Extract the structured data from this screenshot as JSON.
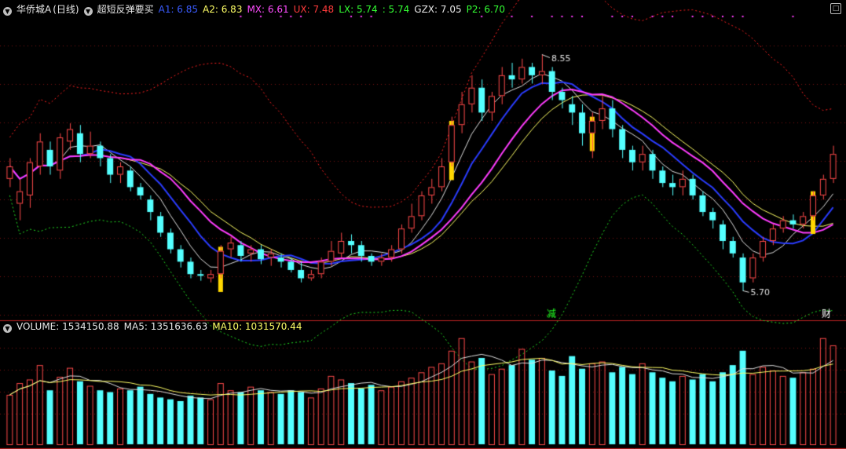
{
  "header": {
    "stock_name": "华侨城A",
    "period": "(日线)",
    "indicator": "超短反弹要买",
    "indicators": [
      {
        "label": "A1: 6.85",
        "color": "#3a5cff"
      },
      {
        "label": "A2: 6.83",
        "color": "#ffff66"
      },
      {
        "label": "MX: 6.61",
        "color": "#ff4dff"
      },
      {
        "label": "UX: 7.48",
        "color": "#ff3b3b"
      },
      {
        "label": "LX: 5.74",
        "color": "#33ff33"
      },
      {
        "label": ": 5.74",
        "color": "#33ff33"
      },
      {
        "label": "GZX: 7.05",
        "color": "#e8e8e8"
      },
      {
        "label": "P2: 6.70",
        "color": "#33ff33"
      }
    ]
  },
  "volume_header": {
    "items": [
      {
        "label": "VOLUME: 1534150.88",
        "color": "#e8e8e8"
      },
      {
        "label": "MA5: 1351636.63",
        "color": "#e8e8e8"
      },
      {
        "label": "MA10: 1031570.44",
        "color": "#ffff66"
      }
    ]
  },
  "annotations": {
    "high_label": "8.55",
    "low_label": "5.70",
    "marker_jian": "减",
    "marker_cai": "财"
  },
  "colors": {
    "background": "#000000",
    "up": "#ff4a4a",
    "down": "#54ffff",
    "grid": "#7a1010",
    "a1": "#2a3cff",
    "mx": "#ff3cff",
    "a2": "#ffff66",
    "gzx": "#e0e0e0",
    "ux": "#ff2020",
    "lx": "#22dd22",
    "signal": "#ffd700",
    "marker_jian": "#22ff22",
    "marker_cai": "#ffffff"
  },
  "chart_data": {
    "type": "candlestick",
    "price_axis": [
      5.4,
      9.0
    ],
    "signal_bar_indices": [
      21,
      44,
      58,
      80
    ],
    "high_index": 53,
    "low_index": 73,
    "candles": [
      [
        7.05,
        7.2,
        6.95,
        7.3
      ],
      [
        6.75,
        6.9,
        6.55,
        7.05
      ],
      [
        6.85,
        7.25,
        6.7,
        7.3
      ],
      [
        7.2,
        7.5,
        7.1,
        7.6
      ],
      [
        7.4,
        7.2,
        7.1,
        7.5
      ],
      [
        7.15,
        7.55,
        7.05,
        7.6
      ],
      [
        7.5,
        7.65,
        7.4,
        7.72
      ],
      [
        7.6,
        7.35,
        7.25,
        7.7
      ],
      [
        7.35,
        7.45,
        7.3,
        7.62
      ],
      [
        7.45,
        7.3,
        7.2,
        7.5
      ],
      [
        7.3,
        7.1,
        7.0,
        7.35
      ],
      [
        7.1,
        7.2,
        7.0,
        7.25
      ],
      [
        7.15,
        6.95,
        6.9,
        7.2
      ],
      [
        6.95,
        6.85,
        6.8,
        7.0
      ],
      [
        6.8,
        6.65,
        6.55,
        6.85
      ],
      [
        6.6,
        6.4,
        6.35,
        6.65
      ],
      [
        6.4,
        6.2,
        6.15,
        6.45
      ],
      [
        6.2,
        6.05,
        5.98,
        6.25
      ],
      [
        6.05,
        5.9,
        5.85,
        6.1
      ],
      [
        5.9,
        5.88,
        5.82,
        5.95
      ],
      [
        5.85,
        5.9,
        5.8,
        5.95
      ],
      [
        5.9,
        6.18,
        5.85,
        6.25
      ],
      [
        6.2,
        6.28,
        6.1,
        6.35
      ],
      [
        6.25,
        6.12,
        6.05,
        6.3
      ],
      [
        6.15,
        6.2,
        6.05,
        6.25
      ],
      [
        6.2,
        6.08,
        6.02,
        6.25
      ],
      [
        6.1,
        6.15,
        6.0,
        6.2
      ],
      [
        6.1,
        6.05,
        5.98,
        6.15
      ],
      [
        6.05,
        5.95,
        5.92,
        6.1
      ],
      [
        5.95,
        5.85,
        5.8,
        6.05
      ],
      [
        5.85,
        5.9,
        5.82,
        5.95
      ],
      [
        5.9,
        6.05,
        5.85,
        6.1
      ],
      [
        6.05,
        6.18,
        6.0,
        6.3
      ],
      [
        6.15,
        6.3,
        6.1,
        6.4
      ],
      [
        6.3,
        6.25,
        6.15,
        6.38
      ],
      [
        6.25,
        6.12,
        6.05,
        6.3
      ],
      [
        6.12,
        6.05,
        6.0,
        6.15
      ],
      [
        6.05,
        6.1,
        6.0,
        6.15
      ],
      [
        6.1,
        6.2,
        6.05,
        6.25
      ],
      [
        6.2,
        6.45,
        6.15,
        6.5
      ],
      [
        6.45,
        6.6,
        6.4,
        6.75
      ],
      [
        6.6,
        6.85,
        6.55,
        6.9
      ],
      [
        6.85,
        6.95,
        6.75,
        7.05
      ],
      [
        6.95,
        7.2,
        6.9,
        7.3
      ],
      [
        7.25,
        7.7,
        7.2,
        7.8
      ],
      [
        7.7,
        7.95,
        7.6,
        8.1
      ],
      [
        7.95,
        8.15,
        7.85,
        8.3
      ],
      [
        8.15,
        7.85,
        7.75,
        8.25
      ],
      [
        7.85,
        8.05,
        7.75,
        8.1
      ],
      [
        8.05,
        8.3,
        7.95,
        8.4
      ],
      [
        8.3,
        8.25,
        8.15,
        8.45
      ],
      [
        8.25,
        8.4,
        8.2,
        8.5
      ],
      [
        8.4,
        8.3,
        8.2,
        8.45
      ],
      [
        8.3,
        8.35,
        8.2,
        8.55
      ],
      [
        8.35,
        8.1,
        8.0,
        8.4
      ],
      [
        8.1,
        8.0,
        7.9,
        8.15
      ],
      [
        7.95,
        7.85,
        7.7,
        8.05
      ],
      [
        7.85,
        7.6,
        7.45,
        7.95
      ],
      [
        7.6,
        7.75,
        7.3,
        7.85
      ],
      [
        7.75,
        7.9,
        7.65,
        8.05
      ],
      [
        7.9,
        7.65,
        7.55,
        8.0
      ],
      [
        7.65,
        7.4,
        7.3,
        7.7
      ],
      [
        7.4,
        7.25,
        7.15,
        7.45
      ],
      [
        7.25,
        7.35,
        7.15,
        7.45
      ],
      [
        7.35,
        7.15,
        7.05,
        7.4
      ],
      [
        7.15,
        7.0,
        6.95,
        7.2
      ],
      [
        7.0,
        6.95,
        6.85,
        7.1
      ],
      [
        6.95,
        7.05,
        6.85,
        7.15
      ],
      [
        7.05,
        6.85,
        6.8,
        7.1
      ],
      [
        6.85,
        6.65,
        6.6,
        6.9
      ],
      [
        6.65,
        6.55,
        6.45,
        6.7
      ],
      [
        6.5,
        6.3,
        6.2,
        6.55
      ],
      [
        6.3,
        6.15,
        6.1,
        6.35
      ],
      [
        6.1,
        5.8,
        5.7,
        6.15
      ],
      [
        5.85,
        6.1,
        5.8,
        6.15
      ],
      [
        6.1,
        6.3,
        6.05,
        6.35
      ],
      [
        6.3,
        6.45,
        6.25,
        6.5
      ],
      [
        6.45,
        6.55,
        6.4,
        6.6
      ],
      [
        6.55,
        6.5,
        6.45,
        6.62
      ],
      [
        6.5,
        6.6,
        6.45,
        6.65
      ],
      [
        6.6,
        6.85,
        6.55,
        6.9
      ],
      [
        6.85,
        7.05,
        6.8,
        7.1
      ],
      [
        7.05,
        7.35,
        7.0,
        7.45
      ]
    ],
    "volume": [
      55,
      68,
      72,
      88,
      60,
      75,
      85,
      70,
      65,
      60,
      58,
      62,
      60,
      64,
      56,
      52,
      50,
      48,
      54,
      52,
      50,
      68,
      60,
      58,
      64,
      60,
      58,
      56,
      60,
      58,
      52,
      62,
      76,
      72,
      68,
      62,
      66,
      60,
      64,
      70,
      74,
      80,
      86,
      90,
      104,
      118,
      92,
      96,
      78,
      84,
      88,
      106,
      94,
      96,
      82,
      76,
      98,
      84,
      90,
      92,
      80,
      86,
      78,
      90,
      80,
      74,
      70,
      76,
      72,
      78,
      70,
      80,
      88,
      104,
      78,
      86,
      82,
      76,
      74,
      80,
      84,
      118,
      110
    ]
  }
}
